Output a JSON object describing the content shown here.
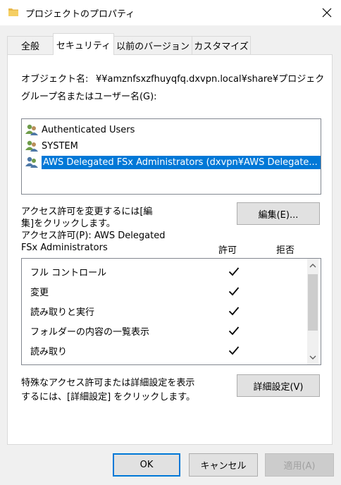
{
  "window": {
    "title": "プロジェクトのプロパティ",
    "close_glyph": "✕"
  },
  "tabs": [
    {
      "label": "全般",
      "active": false
    },
    {
      "label": "セキュリティ",
      "active": true
    },
    {
      "label": "以前のバージョン",
      "active": false
    },
    {
      "label": "カスタマイズ",
      "active": false
    }
  ],
  "security": {
    "object_name_label": "オブジェクト名:",
    "object_name_value": "¥¥amznfsxzfhuyqfq.dxvpn.local¥share¥プロジェクト",
    "group_label": "グループ名またはユーザー名(G):",
    "principals": [
      {
        "name": "Authenticated Users",
        "icon": "users-icon",
        "selected": false
      },
      {
        "name": "SYSTEM",
        "icon": "users-icon",
        "selected": false
      },
      {
        "name": "AWS Delegated FSx Administrators (dxvpn¥AWS Delegate...",
        "icon": "users-icon",
        "selected": true
      }
    ],
    "change_hint_line1": "アクセス許可を変更するには[編",
    "change_hint_line2": "集]をクリックします。",
    "edit_button": "編集(E)...",
    "perm_label_line1": "アクセス許可(P): AWS Delegated",
    "perm_label_line2": "FSx Administrators",
    "allow_header": "許可",
    "deny_header": "拒否",
    "permissions": [
      {
        "name": "フル コントロール",
        "allow": true,
        "deny": false
      },
      {
        "name": "変更",
        "allow": true,
        "deny": false
      },
      {
        "name": "読み取りと実行",
        "allow": true,
        "deny": false
      },
      {
        "name": "フォルダーの内容の一覧表示",
        "allow": true,
        "deny": false
      },
      {
        "name": "読み取り",
        "allow": true,
        "deny": false
      }
    ],
    "advanced_hint_line1": "特殊なアクセス許可または詳細設定を表示",
    "advanced_hint_line2": "するには、[詳細設定] をクリックします。",
    "advanced_button": "詳細設定(V)"
  },
  "footer": {
    "ok": "OK",
    "cancel": "キャンセル",
    "apply": "適用(A)"
  },
  "colors": {
    "selection": "#0078d7",
    "accent_border": "#0078d7"
  }
}
